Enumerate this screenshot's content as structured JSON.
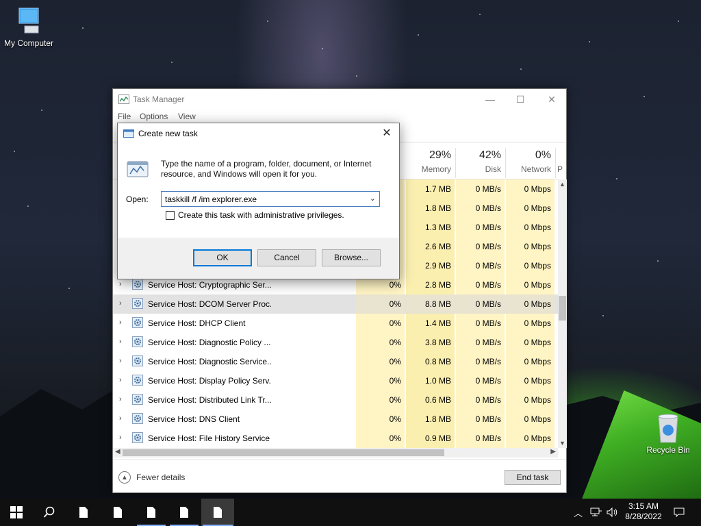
{
  "desktop": {
    "my_computer": "My Computer",
    "recycle_bin": "Recycle Bin"
  },
  "task_manager": {
    "title": "Task Manager",
    "menu": [
      "File",
      "Options",
      "View"
    ],
    "columns": {
      "memory_pct": "29%",
      "memory": "Memory",
      "disk_pct": "42%",
      "disk": "Disk",
      "network_pct": "0%",
      "network": "Network",
      "power_cut": "P"
    },
    "rows": [
      {
        "name": "",
        "cpu": "",
        "mem": "1.7 MB",
        "disk": "0 MB/s",
        "net": "0 Mbps"
      },
      {
        "name": "",
        "cpu": "",
        "mem": "1.8 MB",
        "disk": "0 MB/s",
        "net": "0 Mbps"
      },
      {
        "name": "",
        "cpu": "",
        "mem": "1.3 MB",
        "disk": "0 MB/s",
        "net": "0 Mbps"
      },
      {
        "name": "",
        "cpu": "",
        "mem": "2.6 MB",
        "disk": "0 MB/s",
        "net": "0 Mbps"
      },
      {
        "name": "",
        "cpu": "",
        "mem": "2.9 MB",
        "disk": "0 MB/s",
        "net": "0 Mbps"
      },
      {
        "name": "Service Host: Cryptographic Ser...",
        "cpu": "0%",
        "mem": "2.8 MB",
        "disk": "0 MB/s",
        "net": "0 Mbps"
      },
      {
        "name": "Service Host: DCOM Server Proc...",
        "cpu": "0%",
        "mem": "8.8 MB",
        "disk": "0 MB/s",
        "net": "0 Mbps"
      },
      {
        "name": "Service Host: DHCP Client",
        "cpu": "0%",
        "mem": "1.4 MB",
        "disk": "0 MB/s",
        "net": "0 Mbps"
      },
      {
        "name": "Service Host: Diagnostic Policy ...",
        "cpu": "0%",
        "mem": "3.8 MB",
        "disk": "0 MB/s",
        "net": "0 Mbps"
      },
      {
        "name": "Service Host: Diagnostic Service...",
        "cpu": "0%",
        "mem": "0.8 MB",
        "disk": "0 MB/s",
        "net": "0 Mbps"
      },
      {
        "name": "Service Host: Display Policy Serv...",
        "cpu": "0%",
        "mem": "1.0 MB",
        "disk": "0 MB/s",
        "net": "0 Mbps"
      },
      {
        "name": "Service Host: Distributed Link Tr...",
        "cpu": "0%",
        "mem": "0.6 MB",
        "disk": "0 MB/s",
        "net": "0 Mbps"
      },
      {
        "name": "Service Host: DNS Client",
        "cpu": "0%",
        "mem": "1.8 MB",
        "disk": "0 MB/s",
        "net": "0 Mbps"
      },
      {
        "name": "Service Host: File History Service",
        "cpu": "0%",
        "mem": "0.9 MB",
        "disk": "0 MB/s",
        "net": "0 Mbps"
      }
    ],
    "selected_row": 6,
    "fewer_details": "Fewer details",
    "end_task": "End task"
  },
  "dialog": {
    "title": "Create new task",
    "message": "Type the name of a program, folder, document, or Internet resource, and Windows will open it for you.",
    "open_label": "Open:",
    "open_value": "taskkill /f /im explorer.exe",
    "admin_checkbox": "Create this task with administrative privileges.",
    "ok": "OK",
    "cancel": "Cancel",
    "browse": "Browse..."
  },
  "taskbar": {
    "time": "3:15 AM",
    "date": "8/28/2022"
  },
  "colors": {
    "cell_highlight": "#fff4c4",
    "accent": "#0078d7"
  }
}
